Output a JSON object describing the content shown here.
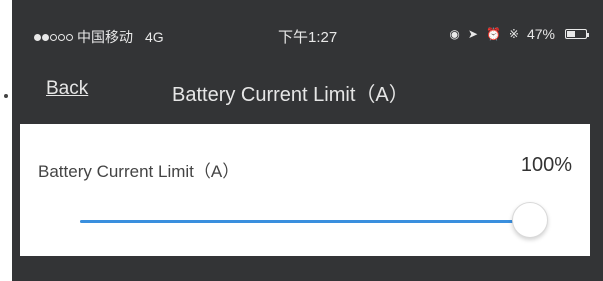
{
  "status_bar": {
    "carrier": "中国移动",
    "network": "4G",
    "time": "下午1:27",
    "battery_percent": "47%",
    "battery_level": 0.47,
    "signal_bars_on": 2,
    "signal_bars_total": 5,
    "icons": [
      "lock-rotation-icon",
      "location-icon",
      "alarm-icon",
      "bluetooth-icon"
    ]
  },
  "nav": {
    "back_label": "Back",
    "title": "Battery Current Limit（A）"
  },
  "setting": {
    "label": "Battery Current Limit（A）",
    "value_text": "100%",
    "value": 1.0
  },
  "colors": {
    "screen_bg": "#333436",
    "panel_bg": "#ffffff",
    "slider_fill": "#3a8fde",
    "slider_track": "#d0d0d0"
  }
}
